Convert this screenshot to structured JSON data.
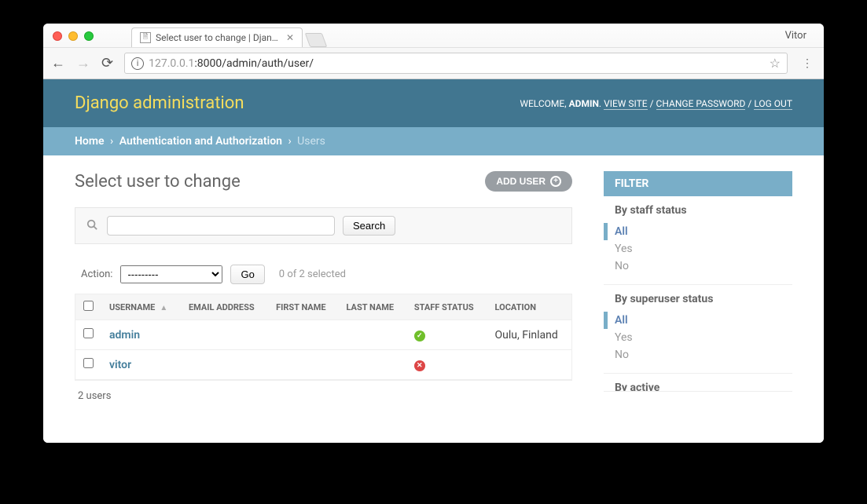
{
  "browser": {
    "user": "Vitor",
    "tab_title": "Select user to change | Django",
    "url_muted": "127.0.0.1",
    "url_rest": ":8000/admin/auth/user/"
  },
  "header": {
    "site_title": "Django administration",
    "welcome": "WELCOME,",
    "username": "ADMIN",
    "view_site": "VIEW SITE",
    "change_password": "CHANGE PASSWORD",
    "log_out": "LOG OUT"
  },
  "breadcrumbs": {
    "home": "Home",
    "section": "Authentication and Authorization",
    "current": "Users"
  },
  "page": {
    "title": "Select user to change",
    "add_label": "ADD USER"
  },
  "search": {
    "button": "Search",
    "value": ""
  },
  "actions": {
    "label": "Action:",
    "placeholder": "---------",
    "go": "Go",
    "selection": "0 of 2 selected"
  },
  "table": {
    "columns": {
      "username": "USERNAME",
      "email": "EMAIL ADDRESS",
      "first_name": "FIRST NAME",
      "last_name": "LAST NAME",
      "staff": "STAFF STATUS",
      "location": "LOCATION"
    },
    "rows": [
      {
        "username": "admin",
        "email": "",
        "first_name": "",
        "last_name": "",
        "staff": true,
        "location": "Oulu, Finland"
      },
      {
        "username": "vitor",
        "email": "",
        "first_name": "",
        "last_name": "",
        "staff": false,
        "location": ""
      }
    ],
    "count_label": "2 users"
  },
  "filters": {
    "title": "FILTER",
    "groups": [
      {
        "heading": "By staff status",
        "options": [
          {
            "label": "All",
            "selected": true
          },
          {
            "label": "Yes",
            "selected": false
          },
          {
            "label": "No",
            "selected": false
          }
        ]
      },
      {
        "heading": "By superuser status",
        "options": [
          {
            "label": "All",
            "selected": true
          },
          {
            "label": "Yes",
            "selected": false
          },
          {
            "label": "No",
            "selected": false
          }
        ]
      },
      {
        "heading": "By active",
        "options": []
      }
    ]
  }
}
